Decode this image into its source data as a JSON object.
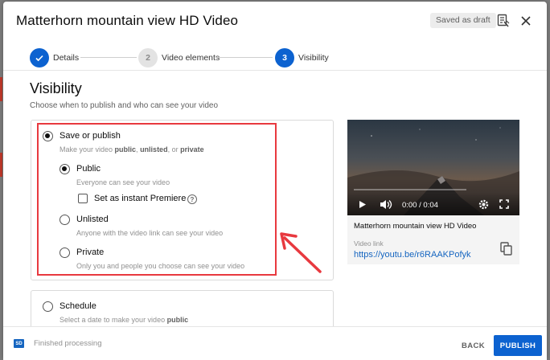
{
  "dialog": {
    "title": "Matterhorn mountain view HD Video",
    "draft_badge": "Saved as draft",
    "icons": {
      "feedback": "feedback-icon",
      "close": "close-icon"
    }
  },
  "stepper": {
    "steps": [
      {
        "label": "Details",
        "number": "1",
        "state": "done"
      },
      {
        "label": "Video elements",
        "number": "2",
        "state": "todo"
      },
      {
        "label": "Visibility",
        "number": "3",
        "state": "active"
      }
    ]
  },
  "visibility": {
    "title": "Visibility",
    "subtitle": "Choose when to publish and who can see your video",
    "save_or_publish": {
      "label": "Save or publish",
      "desc_prefix": "Make your video ",
      "desc_public": "public",
      "desc_sep1": ", ",
      "desc_unlisted": "unlisted",
      "desc_sep2": ", or ",
      "desc_private": "private",
      "selected": true
    },
    "options": [
      {
        "label": "Public",
        "desc": "Everyone can see your video",
        "selected": true
      },
      {
        "label": "Unlisted",
        "desc": "Anyone with the video link can see your video",
        "selected": false
      },
      {
        "label": "Private",
        "desc": "Only you and people you choose can see your video",
        "selected": false
      }
    ],
    "premiere_label": "Set as instant Premiere",
    "schedule": {
      "label": "Schedule",
      "desc_prefix": "Select a date to make your video ",
      "desc_bold": "public"
    }
  },
  "video": {
    "time": "0:00 / 0:04",
    "name": "Matterhorn mountain view HD Video",
    "link_label": "Video link",
    "link": "https://youtu.be/r6RAAKPofyk"
  },
  "footer": {
    "sd_badge": "SD",
    "status": "Finished processing",
    "back_label": "BACK",
    "publish_label": "PUBLISH"
  },
  "colors": {
    "accent": "#0c62d0",
    "highlight": "#e8393f",
    "link": "#1565c0"
  }
}
